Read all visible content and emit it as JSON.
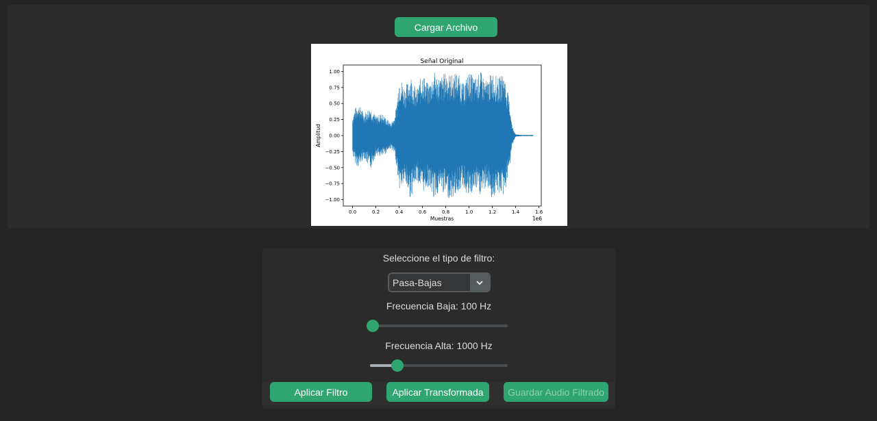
{
  "top": {
    "load_button": "Cargar Archivo"
  },
  "chart_data": {
    "type": "line",
    "title": "Señal Original",
    "xlabel": "Muestras",
    "ylabel": "Amplitud",
    "x_offset_label": "1e6",
    "xlim": [
      -0.08,
      1.62
    ],
    "ylim": [
      -1.1,
      1.1
    ],
    "x_ticks": [
      0.0,
      0.2,
      0.4,
      0.6,
      0.8,
      1.0,
      1.2,
      1.4,
      1.6
    ],
    "x_tick_labels": [
      "0.0",
      "0.2",
      "0.4",
      "0.6",
      "0.8",
      "1.0",
      "1.2",
      "1.4",
      "1.6"
    ],
    "y_ticks": [
      1.0,
      0.75,
      0.5,
      0.25,
      0.0,
      -0.25,
      -0.5,
      -0.75,
      -1.0
    ],
    "y_tick_labels": [
      "1.00",
      "0.75",
      "0.50",
      "0.25",
      "0.00",
      "−0.25",
      "−0.50",
      "−0.75",
      "−1.00"
    ],
    "color": "#1f77b4",
    "envelope": {
      "x": [
        0.0,
        0.02,
        0.05,
        0.1,
        0.15,
        0.2,
        0.25,
        0.3,
        0.33,
        0.36,
        0.38,
        0.4,
        0.45,
        0.5,
        0.55,
        0.6,
        0.65,
        0.7,
        0.75,
        0.8,
        0.85,
        0.9,
        0.95,
        1.0,
        1.05,
        1.1,
        1.15,
        1.2,
        1.25,
        1.3,
        1.33,
        1.35,
        1.37,
        1.4,
        1.45,
        1.5,
        1.55
      ],
      "upper": [
        0.3,
        0.42,
        0.5,
        0.35,
        0.45,
        0.3,
        0.35,
        0.25,
        0.2,
        0.3,
        0.5,
        0.95,
        0.75,
        0.95,
        0.7,
        1.0,
        0.8,
        1.0,
        0.9,
        1.0,
        0.95,
        1.0,
        0.8,
        1.0,
        0.9,
        1.0,
        0.85,
        1.0,
        0.9,
        0.98,
        0.7,
        0.5,
        0.15,
        0.02,
        0.01,
        0.01,
        0.01
      ],
      "lower": [
        -0.3,
        -0.42,
        -0.5,
        -0.35,
        -0.55,
        -0.3,
        -0.35,
        -0.25,
        -0.2,
        -0.3,
        -0.5,
        -0.85,
        -0.75,
        -1.0,
        -0.7,
        -0.9,
        -0.8,
        -1.0,
        -0.85,
        -0.95,
        -1.0,
        -0.9,
        -0.8,
        -1.0,
        -0.85,
        -0.95,
        -0.8,
        -1.0,
        -0.9,
        -0.95,
        -0.7,
        -0.5,
        -0.15,
        -0.02,
        -0.01,
        -0.01,
        -0.01
      ]
    }
  },
  "filter": {
    "type_label": "Seleccione el tipo de filtro:",
    "selected_type": "Pasa-Bajas",
    "low_label": "Frecuencia Baja: 100 Hz",
    "low_value_fraction": 0.02,
    "high_label": "Frecuencia Alta: 1000 Hz",
    "high_value_fraction": 0.2,
    "apply_filter": "Aplicar Filtro",
    "apply_transform": "Aplicar Transformada",
    "save_audio": "Guardar Audio Filtrado"
  },
  "colors": {
    "accent": "#2fa572",
    "background": "#242424",
    "panel": "#2b2b2b"
  }
}
